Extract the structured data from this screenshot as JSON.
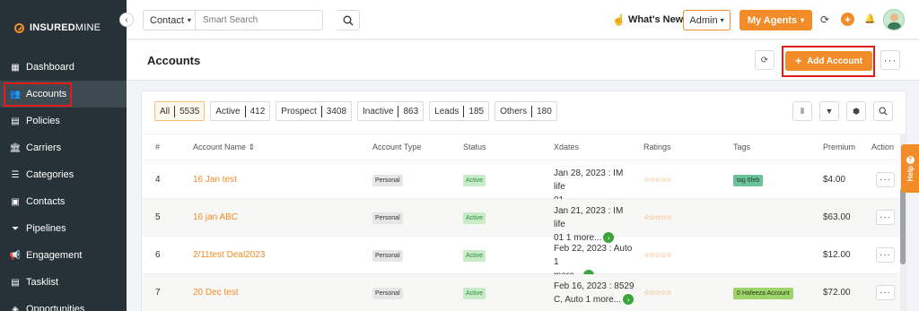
{
  "brand": {
    "name_bold": "INSURED",
    "name_light": "MINE"
  },
  "sidebar": {
    "items": [
      {
        "label": "Dashboard",
        "icon": "dashboard-icon",
        "glyph": "▦"
      },
      {
        "label": "Accounts",
        "icon": "accounts-icon",
        "glyph": "👥"
      },
      {
        "label": "Policies",
        "icon": "policies-icon",
        "glyph": "▤"
      },
      {
        "label": "Carriers",
        "icon": "carriers-icon",
        "glyph": "🏛"
      },
      {
        "label": "Categories",
        "icon": "categories-icon",
        "glyph": "☰"
      },
      {
        "label": "Contacts",
        "icon": "contacts-icon",
        "glyph": "▣"
      },
      {
        "label": "Pipelines",
        "icon": "pipelines-icon",
        "glyph": "⏷"
      },
      {
        "label": "Engagement",
        "icon": "engagement-icon",
        "glyph": "📢"
      },
      {
        "label": "Tasklist",
        "icon": "tasklist-icon",
        "glyph": "▤"
      },
      {
        "label": "Opportunities",
        "icon": "opportunities-icon",
        "glyph": "◈"
      }
    ],
    "active_index": 1
  },
  "topbar": {
    "search_scope": "Contact",
    "search_placeholder": "Smart Search",
    "whats_new": "What's New",
    "admin_label": "Admin",
    "my_agents_label": "My Agents"
  },
  "page": {
    "title": "Accounts",
    "add_button": "Add Account"
  },
  "filters": [
    {
      "label": "All",
      "count": "5535",
      "active": true
    },
    {
      "label": "Active",
      "count": "412"
    },
    {
      "label": "Prospect",
      "count": "3408"
    },
    {
      "label": "Inactive",
      "count": "863"
    },
    {
      "label": "Leads",
      "count": "185"
    },
    {
      "label": "Others",
      "count": "180"
    }
  ],
  "table": {
    "columns": [
      "#",
      "Account Name",
      "Account Type",
      "Status",
      "Xdates",
      "Ratings",
      "Tags",
      "Premium",
      "Action"
    ],
    "rows": [
      {
        "num": "4",
        "name": "16 Jan test",
        "type": "Personal",
        "status": "Active",
        "xdate_l1": "Jan 28, 2023 : IM life",
        "xdate_l2": "01",
        "more": "",
        "tag": "tag 6feb",
        "premium": "$4.00"
      },
      {
        "num": "5",
        "name": "16 jan ABC",
        "type": "Personal",
        "status": "Active",
        "xdate_l1": "Jan 21, 2023 : IM life",
        "xdate_l2": "01 1 more...",
        "more": "›",
        "tag": "",
        "premium": "$63.00"
      },
      {
        "num": "6",
        "name": "2/11test Deal2023",
        "type": "Personal",
        "status": "Active",
        "xdate_l1": "Feb 22, 2023 : Auto 1",
        "xdate_l2": "more...",
        "more": "›",
        "tag": "",
        "premium": "$12.00"
      },
      {
        "num": "7",
        "name": "20 Dec test",
        "type": "Personal",
        "status": "Active",
        "xdate_l1": "Feb 16, 2023 : 8529",
        "xdate_l2": "C, Auto 1 more...",
        "more": "›",
        "tag": "0 Hafeeza Account",
        "premium": "$72.00"
      }
    ],
    "rating_stars": "☆☆☆☆☆"
  },
  "help_label": "Help",
  "colors": {
    "accent": "#f28c28",
    "sidebar": "#263238",
    "highlight": "#e21b1b"
  }
}
